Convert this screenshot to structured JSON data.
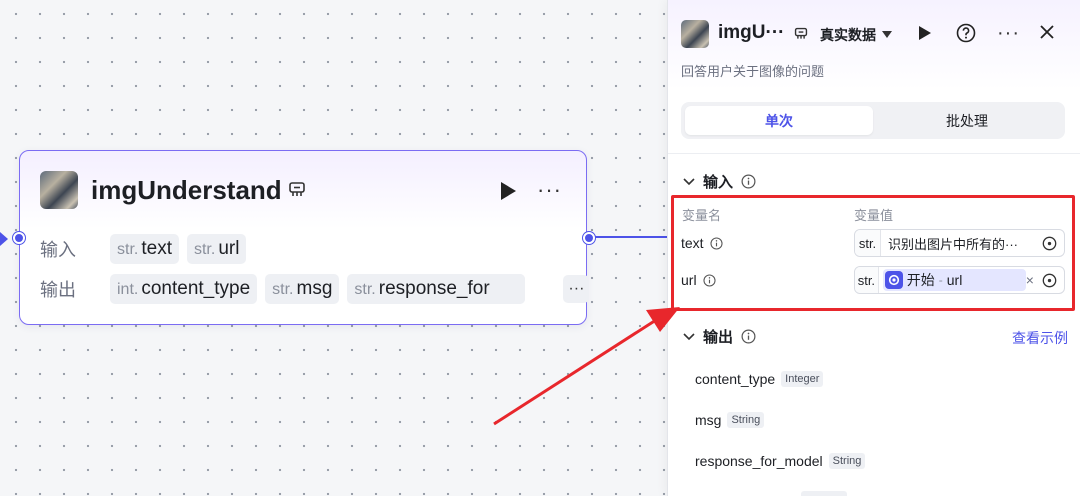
{
  "node": {
    "title": "imgUnderstand",
    "input_label": "输入",
    "output_label": "输出",
    "inputs": [
      {
        "type": "str.",
        "name": "text"
      },
      {
        "type": "str.",
        "name": "url"
      }
    ],
    "outputs": [
      {
        "type": "int.",
        "name": "content_type"
      },
      {
        "type": "str.",
        "name": "msg"
      },
      {
        "type": "str.",
        "name": "response_for"
      }
    ],
    "more_label": "···",
    "outputs_more_label": "···"
  },
  "panel": {
    "title": "imgU···",
    "mode": "真实数据",
    "more_label": "···",
    "description": "回答用户关于图像的问题",
    "tabs": [
      {
        "label": "单次",
        "active": true
      },
      {
        "label": "批处理",
        "active": false
      }
    ],
    "input_section": {
      "title": "输入",
      "col_name": "变量名",
      "col_value": "变量值",
      "rows": [
        {
          "name": "text",
          "type": "str.",
          "value": "识别出图片中所有的···"
        },
        {
          "name": "url",
          "type": "str.",
          "ref_source": "开始",
          "ref_sep": "-",
          "ref_field": "url",
          "clear": "×"
        }
      ]
    },
    "output_section": {
      "title": "输出",
      "view_example": "查看示例",
      "items": [
        {
          "name": "content_type",
          "type": "Integer"
        },
        {
          "name": "msg",
          "type": "String"
        },
        {
          "name": "response_for_model",
          "type": "String"
        }
      ]
    }
  },
  "colors": {
    "accent": "#4d53e8",
    "node_border": "#7b6cf3",
    "annotation": "#e8272c"
  }
}
